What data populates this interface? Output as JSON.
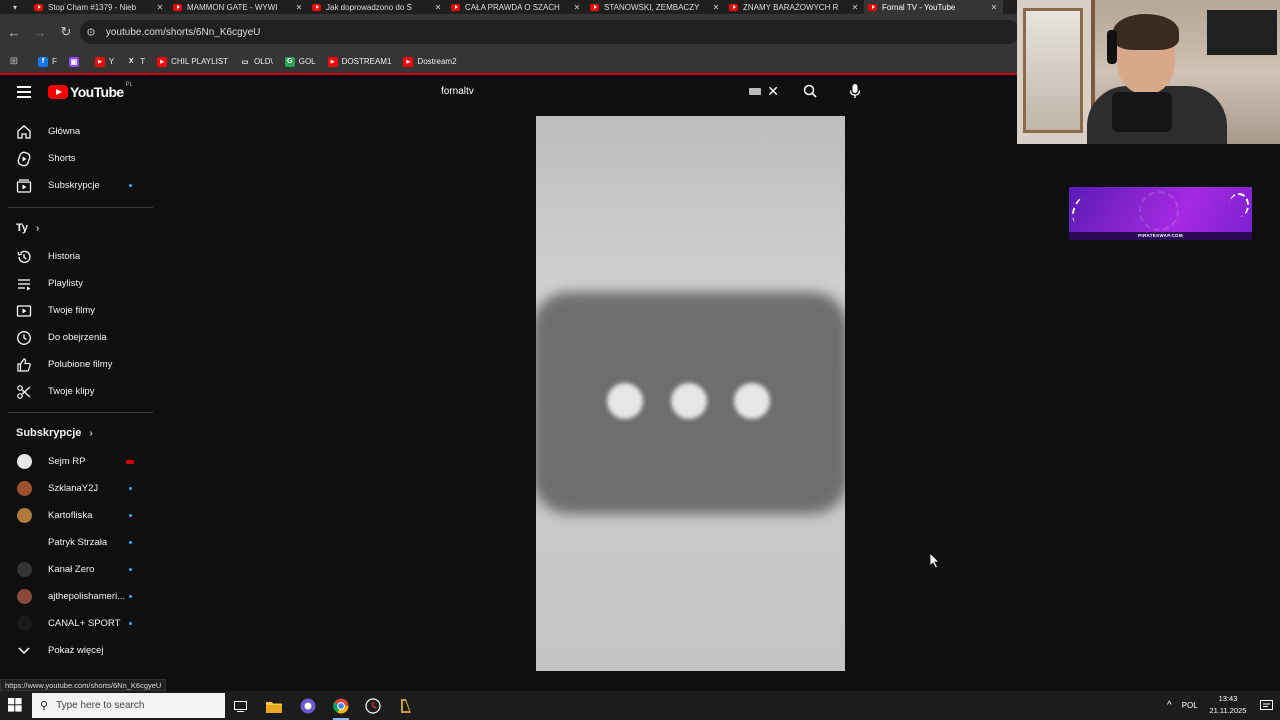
{
  "browser": {
    "tabs": [
      {
        "title": "Stop Cham #1379 - Nieb",
        "active": false
      },
      {
        "title": "MAMMON GATE - WYWI",
        "active": false
      },
      {
        "title": "Jak doprowadzono do Ś",
        "active": false
      },
      {
        "title": "CAŁA PRAWDA O SZACH",
        "active": false
      },
      {
        "title": "STANOWSKI, ZEMBACZY",
        "active": false
      },
      {
        "title": "ZNAMY BARAŻOWYCH R",
        "active": false
      },
      {
        "title": "Fornal TV - YouTube",
        "active": true
      }
    ],
    "url": "youtube.com/shorts/6Nn_K6cgyeU",
    "bookmarks": [
      {
        "label": "F",
        "icon": "facebook-icon",
        "color": "#1877f2"
      },
      {
        "label": "",
        "icon": "twitch-icon",
        "color": "#9146ff"
      },
      {
        "label": "Y",
        "icon": "youtube-icon",
        "color": "#ff0000"
      },
      {
        "label": "T",
        "icon": "x-icon",
        "color": "#000000"
      },
      {
        "label": "CHIL PLAYLIST",
        "icon": "youtube-icon",
        "color": "#ff0000"
      },
      {
        "label": "OLD\\",
        "icon": "folder-icon",
        "color": "#cccccc"
      },
      {
        "label": "GOL",
        "icon": "gol-icon",
        "color": "#29a35a"
      },
      {
        "label": "DOSTREAM1",
        "icon": "youtube-icon",
        "color": "#ff0000"
      },
      {
        "label": "Dostream2",
        "icon": "youtube-icon",
        "color": "#ff0000"
      }
    ]
  },
  "youtube": {
    "logo_text": "YouTube",
    "country_code": "PL",
    "search_value": "fornaltv",
    "sidebar": {
      "main": [
        {
          "label": "Główna",
          "icon": "home-icon",
          "dot": false
        },
        {
          "label": "Shorts",
          "icon": "shorts-icon",
          "dot": false
        },
        {
          "label": "Subskrypcje",
          "icon": "subscriptions-icon",
          "dot": true
        }
      ],
      "you_header": "Ty",
      "you": [
        {
          "label": "Historia",
          "icon": "history-icon"
        },
        {
          "label": "Playlisty",
          "icon": "playlists-icon"
        },
        {
          "label": "Twoje filmy",
          "icon": "your-videos-icon"
        },
        {
          "label": "Do obejrzenia",
          "icon": "watch-later-icon"
        },
        {
          "label": "Polubione filmy",
          "icon": "liked-icon"
        },
        {
          "label": "Twoje klipy",
          "icon": "clips-icon"
        }
      ],
      "subs_header": "Subskrypcje",
      "subscriptions": [
        {
          "label": "Sejm RP",
          "live": true,
          "avatar_color": "#e8e8e8"
        },
        {
          "label": "SzklanaY2J",
          "live": false,
          "avatar_color": "#a0522d"
        },
        {
          "label": "Kartofliska",
          "live": false,
          "avatar_color": "#b07a3a"
        },
        {
          "label": "Patryk Strzała",
          "live": false,
          "avatar_color": "#111111"
        },
        {
          "label": "Kanał Zero",
          "live": false,
          "avatar_color": "#333333"
        },
        {
          "label": "ajthepolishameri...",
          "live": false,
          "avatar_color": "#8a4a3a"
        },
        {
          "label": "CANAL+ SPORT",
          "live": false,
          "avatar_color": "#1a1a1a"
        }
      ],
      "show_more": "Pokaż więcej"
    }
  },
  "ad_banner": {
    "brand": "PIRATESWAP.COM"
  },
  "status_link": "https://www.youtube.com/shorts/6Nn_K6cgyeU",
  "taskbar": {
    "search_placeholder": "Type here to search",
    "language": "POL",
    "time": "13:43",
    "date": "21.11.2025"
  }
}
